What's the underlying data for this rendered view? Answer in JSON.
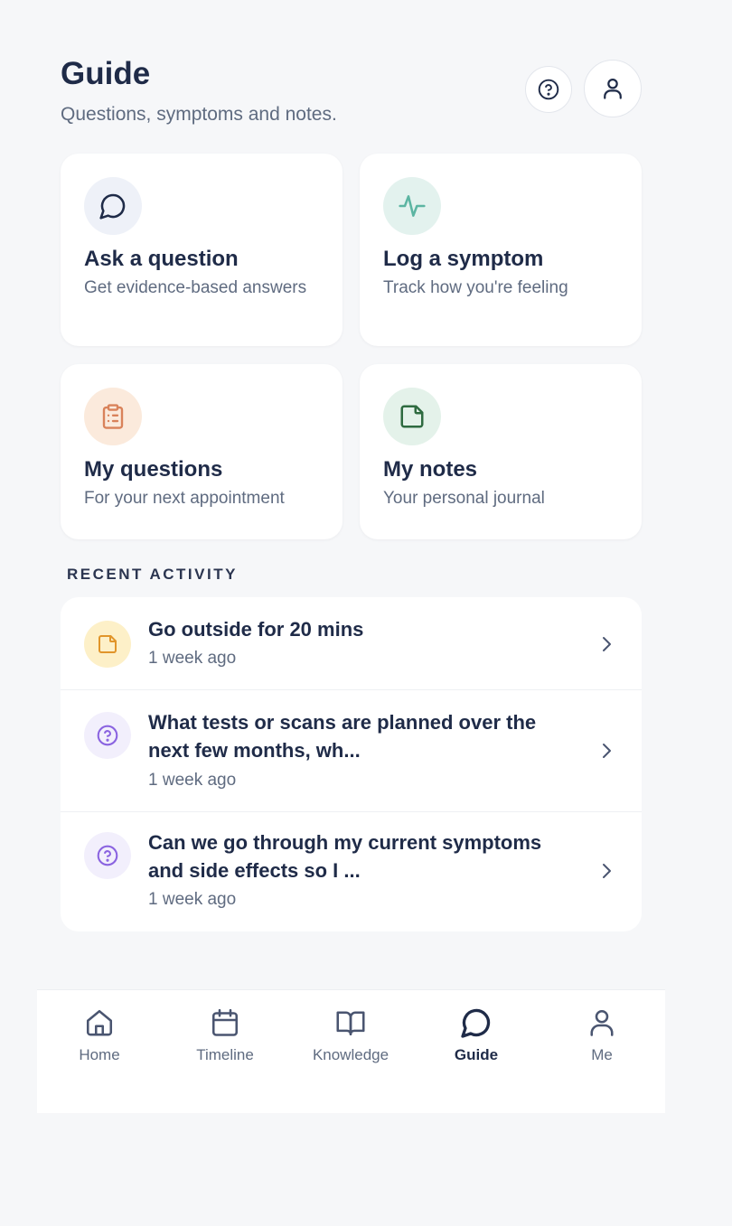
{
  "header": {
    "title": "Guide",
    "subtitle": "Questions, symptoms and notes."
  },
  "icons": {
    "help": "help-circle-icon",
    "profile": "user-icon"
  },
  "cards": [
    {
      "title": "Ask a question",
      "desc": "Get evidence-based answers",
      "icon": "message-circle-icon",
      "icon_bg": "#eef1f8",
      "icon_color": "#1f2b48"
    },
    {
      "title": "Log a symptom",
      "desc": "Track how you're feeling",
      "icon": "activity-icon",
      "icon_bg": "#e3f2ee",
      "icon_color": "#5cb5a2"
    },
    {
      "title": "My questions",
      "desc": "For your next appointment",
      "icon": "clipboard-list-icon",
      "icon_bg": "#fbeadc",
      "icon_color": "#d9825a"
    },
    {
      "title": "My notes",
      "desc": "Your personal journal",
      "icon": "sticky-note-icon",
      "icon_bg": "#e4f2ea",
      "icon_color": "#2e6b40"
    }
  ],
  "recent": {
    "label": "RECENT ACTIVITY",
    "items": [
      {
        "title": "Go outside for 20 mins",
        "time": "1 week ago",
        "icon": "note-icon",
        "icon_bg": "#fdf0c8",
        "icon_color": "#e1952a"
      },
      {
        "title": "What tests or scans are planned over the next few months, wh...",
        "time": "1 week ago",
        "icon": "question-icon",
        "icon_bg": "#f2effc",
        "icon_color": "#8a63e0"
      },
      {
        "title": "Can we go through my current symptoms and side effects so I ...",
        "time": "1 week ago",
        "icon": "question-icon",
        "icon_bg": "#f2effc",
        "icon_color": "#8a63e0"
      }
    ]
  },
  "nav": {
    "items": [
      {
        "label": "Home",
        "icon": "home-icon"
      },
      {
        "label": "Timeline",
        "icon": "calendar-icon"
      },
      {
        "label": "Knowledge",
        "icon": "book-open-icon"
      },
      {
        "label": "Guide",
        "icon": "message-circle-icon",
        "active": true
      },
      {
        "label": "Me",
        "icon": "user-icon"
      }
    ]
  }
}
